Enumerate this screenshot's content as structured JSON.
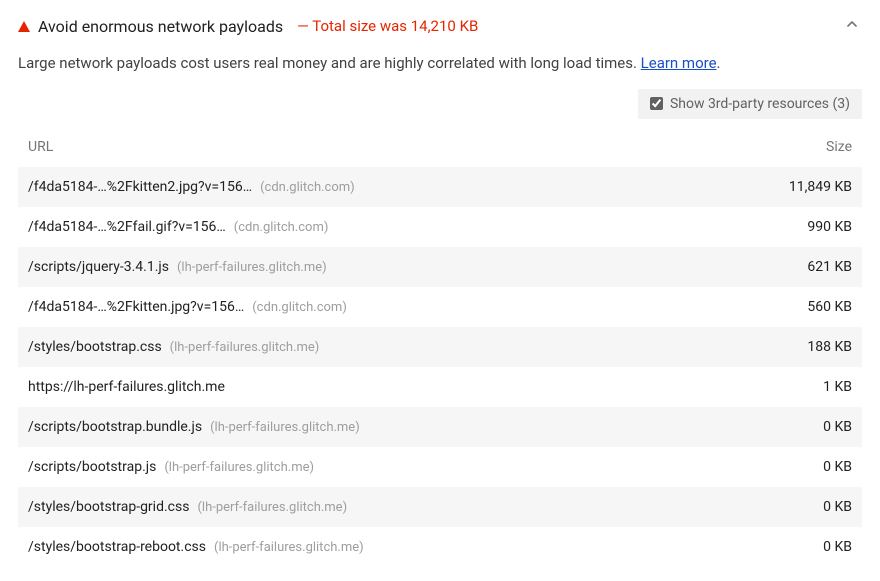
{
  "audit": {
    "title": "Avoid enormous network payloads",
    "summary": "Total size was 14,210 KB",
    "description": "Large network payloads cost users real money and are highly correlated with long load times. ",
    "learn_more": "Learn more"
  },
  "third_party": {
    "label": "Show 3rd-party resources (3)"
  },
  "table": {
    "headers": {
      "url": "URL",
      "size": "Size"
    },
    "rows": [
      {
        "path": "/f4da5184-…%2Fkitten2.jpg?v=156…",
        "host": "(cdn.glitch.com)",
        "size": "11,849 KB"
      },
      {
        "path": "/f4da5184-…%2Ffail.gif?v=156…",
        "host": "(cdn.glitch.com)",
        "size": "990 KB"
      },
      {
        "path": "/scripts/jquery-3.4.1.js",
        "host": "(lh-perf-failures.glitch.me)",
        "size": "621 KB"
      },
      {
        "path": "/f4da5184-…%2Fkitten.jpg?v=156…",
        "host": "(cdn.glitch.com)",
        "size": "560 KB"
      },
      {
        "path": "/styles/bootstrap.css",
        "host": "(lh-perf-failures.glitch.me)",
        "size": "188 KB"
      },
      {
        "path": "https://lh-perf-failures.glitch.me",
        "host": "",
        "size": "1 KB"
      },
      {
        "path": "/scripts/bootstrap.bundle.js",
        "host": "(lh-perf-failures.glitch.me)",
        "size": "0 KB"
      },
      {
        "path": "/scripts/bootstrap.js",
        "host": "(lh-perf-failures.glitch.me)",
        "size": "0 KB"
      },
      {
        "path": "/styles/bootstrap-grid.css",
        "host": "(lh-perf-failures.glitch.me)",
        "size": "0 KB"
      },
      {
        "path": "/styles/bootstrap-reboot.css",
        "host": "(lh-perf-failures.glitch.me)",
        "size": "0 KB"
      }
    ]
  }
}
